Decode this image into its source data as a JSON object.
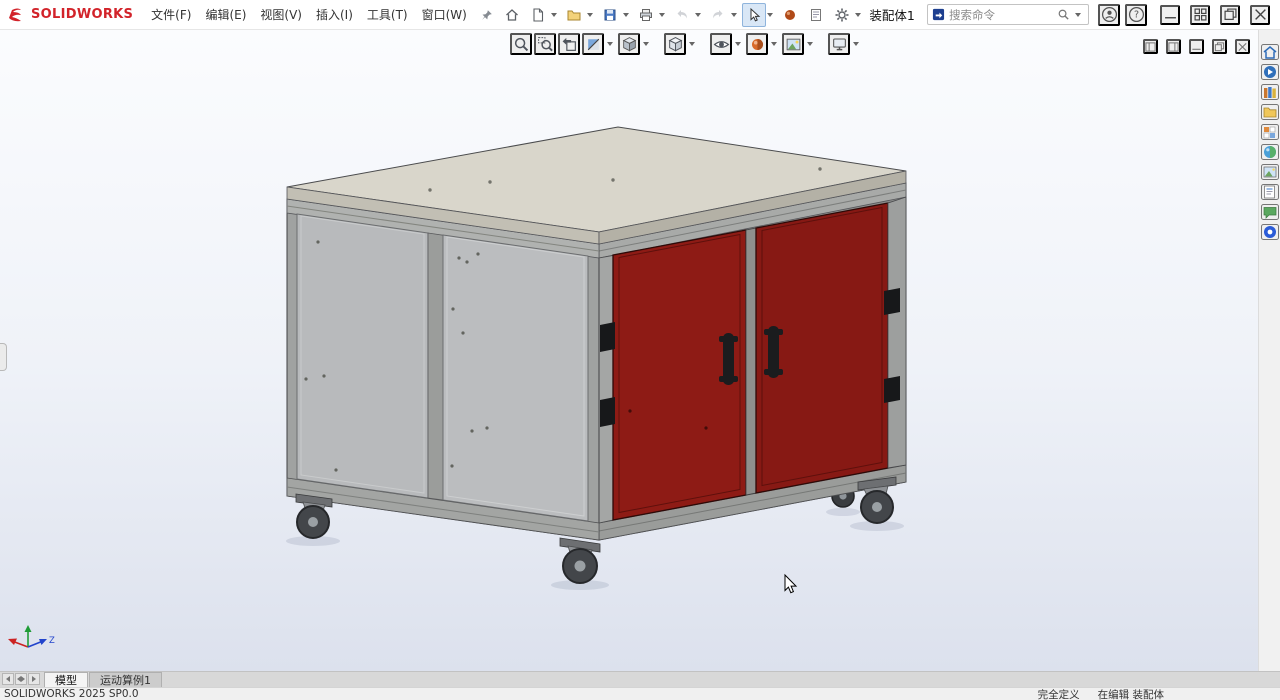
{
  "colors": {
    "brand-red": "#d2232a",
    "door-red": "#8e1b15",
    "door-red-dark": "#871914",
    "panel-gray": "#b8babc",
    "frame-gray": "#a0a2a1",
    "top-face": "#d9d6cb",
    "select-blue": "#d9e7f6",
    "viewport-top": "#fbfcfe",
    "viewport-bottom": "#dce1ed"
  },
  "app": {
    "brand": "SOLIDWORKS",
    "document_title": "装配体1"
  },
  "menubar": {
    "items": [
      {
        "label": "文件(F)"
      },
      {
        "label": "编辑(E)"
      },
      {
        "label": "视图(V)"
      },
      {
        "label": "插入(I)"
      },
      {
        "label": "工具(T)"
      },
      {
        "label": "窗口(W)"
      }
    ]
  },
  "main_toolbar": {
    "icons": [
      "home",
      "new-document",
      "open-document",
      "save",
      "print",
      "undo",
      "redo",
      "select",
      "rebuild",
      "file-properties",
      "options"
    ]
  },
  "headsup_toolbar": {
    "icons": [
      "zoom-to-fit",
      "zoom-to-area",
      "previous-view",
      "section-view",
      "view-orientation",
      "display-style",
      "hide-show-items",
      "edit-appearance",
      "apply-scene",
      "view-settings"
    ]
  },
  "search": {
    "placeholder": "搜索命令"
  },
  "window_controls": {
    "icons": [
      "minimize",
      "window-layout",
      "restore",
      "close"
    ]
  },
  "taskpane": {
    "icons": [
      "home",
      "solidworks-resources",
      "design-library",
      "file-explorer",
      "view-palette",
      "appearances",
      "scenes",
      "custom-properties",
      "forum",
      "marketplace"
    ]
  },
  "tabbar": {
    "tabs": [
      {
        "label": "模型",
        "active": true
      },
      {
        "label": "运动算例1",
        "active": false
      }
    ]
  },
  "statusbar": {
    "version": "SOLIDWORKS 2025 SP0.0",
    "define_state": "完全定义",
    "edit_state": "在编辑",
    "doc_type": "装配体"
  }
}
